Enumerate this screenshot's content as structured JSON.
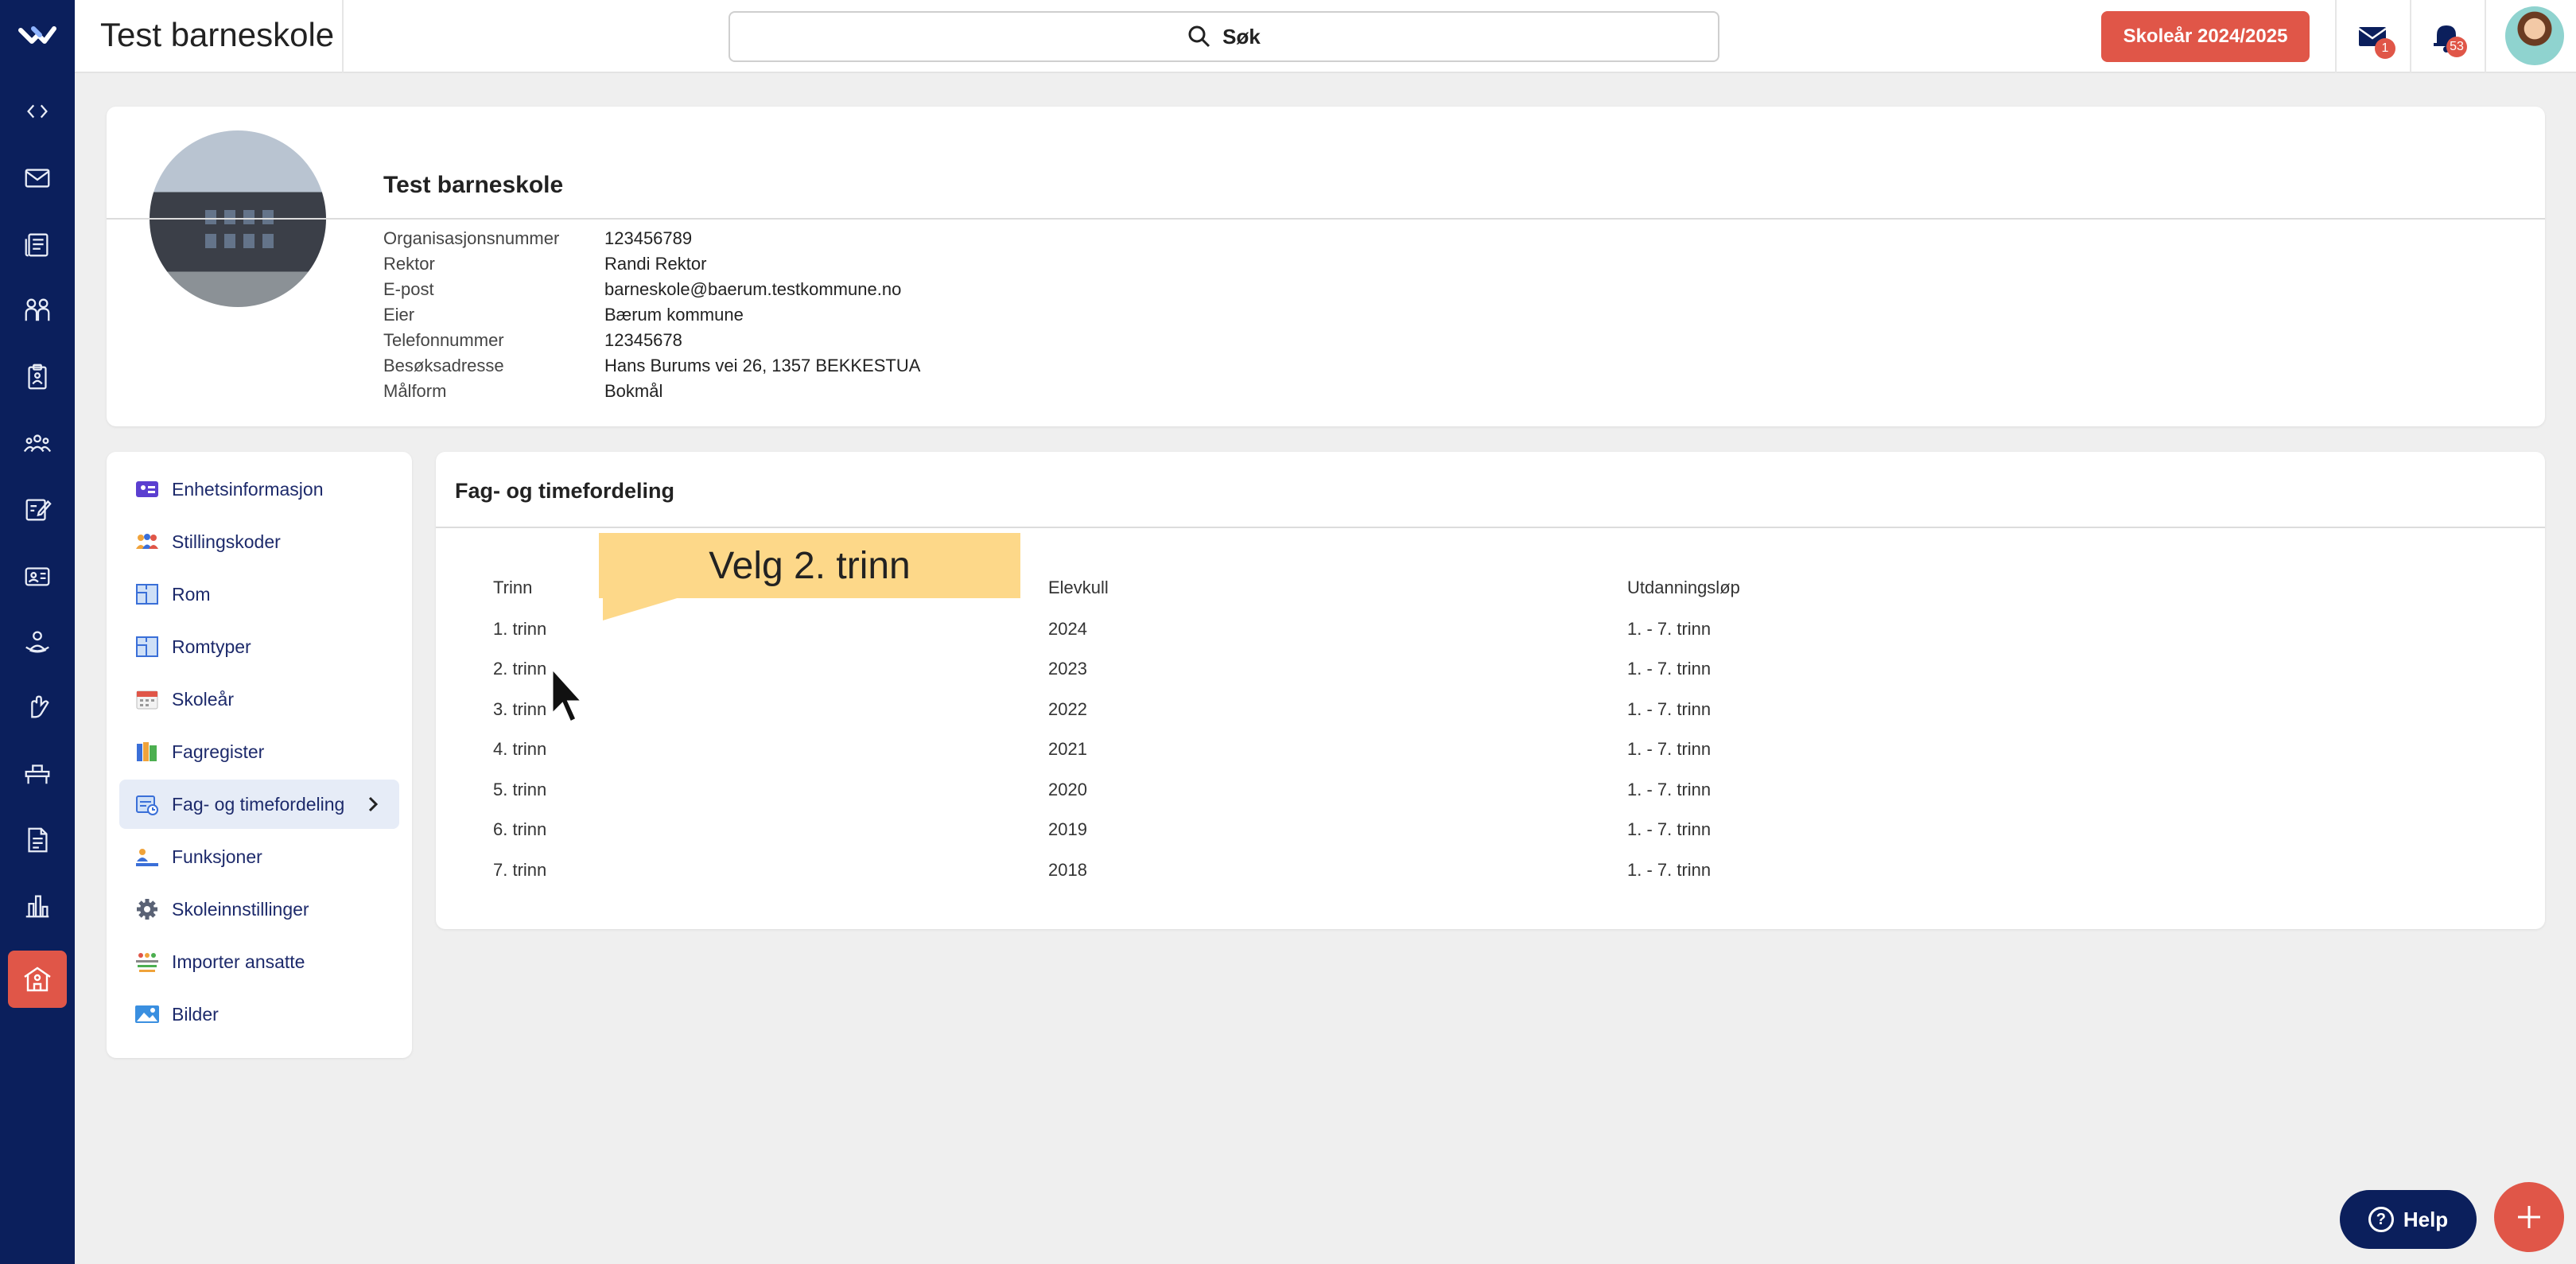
{
  "app": {
    "title": "Test barneskole",
    "search_label": "Søk",
    "school_year_button": "Skoleår 2024/2025",
    "mail_badge": "1",
    "notifications_badge": "53",
    "help_label": "Help"
  },
  "rail_icons": [
    "code-icon",
    "mail-icon",
    "news-icon",
    "people-icon",
    "clipboard-icon",
    "group-icon",
    "edit-doc-icon",
    "id-card-icon",
    "person-icon",
    "hand-icon",
    "desk-icon",
    "document-icon",
    "bar-chart-icon",
    "school-icon"
  ],
  "school": {
    "name": "Test barneskole",
    "info": [
      {
        "label": "Organisasjonsnummer",
        "value": "123456789"
      },
      {
        "label": "Rektor",
        "value": "Randi Rektor"
      },
      {
        "label": "E-post",
        "value": "barneskole@baerum.testkommune.no"
      },
      {
        "label": "Eier",
        "value": "Bærum kommune"
      },
      {
        "label": "Telefonnummer",
        "value": "12345678"
      },
      {
        "label": "Besøksadresse",
        "value": "Hans Burums vei 26, 1357 BEKKESTUA"
      },
      {
        "label": "Målform",
        "value": "Bokmål"
      }
    ]
  },
  "menu": {
    "items": [
      {
        "label": "Enhetsinformasjon",
        "icon": "id-card-icon"
      },
      {
        "label": "Stillingskoder",
        "icon": "people-icon"
      },
      {
        "label": "Rom",
        "icon": "floorplan-icon"
      },
      {
        "label": "Romtyper",
        "icon": "floorplan-icon"
      },
      {
        "label": "Skoleår",
        "icon": "calendar-icon"
      },
      {
        "label": "Fagregister",
        "icon": "books-icon"
      },
      {
        "label": "Fag- og timefordeling",
        "icon": "schedule-icon",
        "selected": true
      },
      {
        "label": "Funksjoner",
        "icon": "functions-icon"
      },
      {
        "label": "Skoleinnstillinger",
        "icon": "gear-icon"
      },
      {
        "label": "Importer ansatte",
        "icon": "import-people-icon"
      },
      {
        "label": "Bilder",
        "icon": "image-icon"
      }
    ]
  },
  "fag": {
    "title": "Fag- og timefordeling",
    "columns": [
      "Trinn",
      "Elevkull",
      "Utdanningsløp"
    ],
    "rows": [
      [
        "1. trinn",
        "2024",
        "1. - 7. trinn"
      ],
      [
        "2. trinn",
        "2023",
        "1. - 7. trinn"
      ],
      [
        "3. trinn",
        "2022",
        "1. - 7. trinn"
      ],
      [
        "4. trinn",
        "2021",
        "1. - 7. trinn"
      ],
      [
        "5. trinn",
        "2020",
        "1. - 7. trinn"
      ],
      [
        "6. trinn",
        "2019",
        "1. - 7. trinn"
      ],
      [
        "7. trinn",
        "2018",
        "1. - 7. trinn"
      ]
    ]
  },
  "callout": {
    "text": "Velg 2. trinn"
  },
  "colors": {
    "rail": "#0b1f5c",
    "accent": "#e05648",
    "callout": "#fdd889",
    "selected": "#e6ecf7"
  }
}
